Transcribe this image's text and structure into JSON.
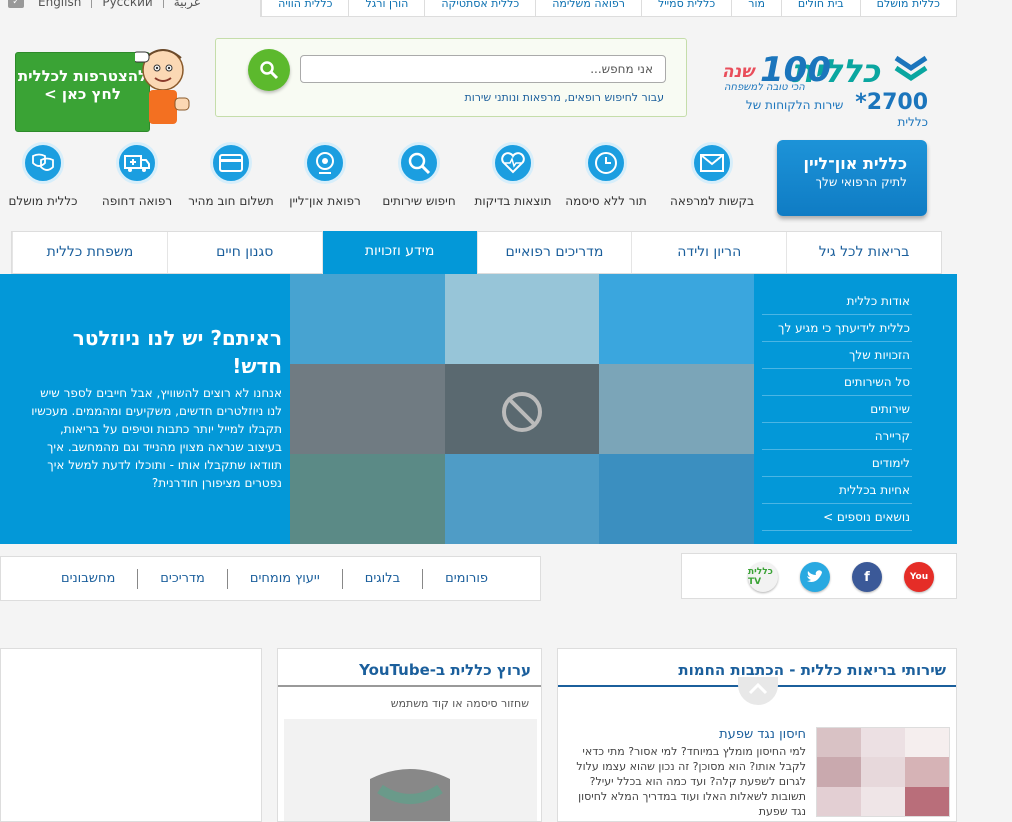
{
  "topbar": {
    "lang_english": "English",
    "lang_russian": "Русский",
    "lang_arabic": "عربية",
    "links": [
      "כללית מושלם",
      "בית חולים",
      "מור",
      "כללית סמייל",
      "רפואה משלימה",
      "כללית אסתטיקה",
      "הורן ורגל",
      "כללית הוויה"
    ]
  },
  "header": {
    "logo_text": "כללית",
    "logo_100": "100",
    "logo_shana": "שנה",
    "logo_tagline": "הכי טובה למשפחה",
    "phone_number": "2700*",
    "phone_label": "שירות הלקוחות של כללית",
    "search_placeholder": "אני מחפש...",
    "search_link": "עבור לחיפוש רופאים, מרפאות ונותני שירות",
    "join_text": "להצטרפות לכללית לחץ כאן >"
  },
  "online": {
    "title": "כללית און־ליין",
    "subtitle": "לתיק הרפואי שלך"
  },
  "icons": [
    {
      "label": "בקשות למרפאה",
      "icon": "envelope-icon"
    },
    {
      "label": "תור ללא סיסמה",
      "icon": "clock-icon"
    },
    {
      "label": "תוצאות בדיקות",
      "icon": "heartbeat-icon"
    },
    {
      "label": "חיפוש שירותים",
      "icon": "search-icon"
    },
    {
      "label": "רפואת און־ליין",
      "icon": "webcam-icon"
    },
    {
      "label": "תשלום חוב מהיר",
      "icon": "credit-card-icon"
    },
    {
      "label": "רפואה דחופה",
      "icon": "ambulance-icon"
    },
    {
      "label": "כללית מושלם",
      "icon": "masks-icon"
    }
  ],
  "tabs": [
    "בריאות לכל גיל",
    "הריון ולידה",
    "מדריכים רפואיים",
    "מידע וזכויות",
    "סגנון חיים",
    "משפחת כללית"
  ],
  "sidemenu": [
    "אודות כללית",
    "כללית לידיעתך כי מגיע לך",
    "הזכויות שלך",
    "סל השירותים",
    "שירותים",
    "קריירה",
    "לימודים",
    "אחיות בכללית",
    "נושאים נוספים >"
  ],
  "promo": {
    "heading": "ראיתם? יש לנו ניוזלטר חדש!",
    "body": "אנחנו לא רוצים להשוויץ, אבל חייבים לספר שיש לנו ניוזלטרים חדשים, משקיעים ומהממים. מעכשיו תקבלו למייל יותר כתבות וטיפים על בריאות, בעיצוב שנראה מצוין מהנייד וגם מהמחשב. איך תוודאו שתקבלו אותו - ותוכלו לדעת למשל איך נפטרים מציפורן חודרנית?"
  },
  "social": {
    "tv_label": "כללית TV"
  },
  "subnav": [
    "פורומים",
    "בלוגים",
    "ייעוץ מומחים",
    "מדריכים",
    "מחשבונים"
  ],
  "card1": {
    "title": "שירותי בריאות כללית - הכתבות החמות",
    "article_title": "חיסון נגד שפעת",
    "article_body": "למי החיסון מומלץ במיוחד? למי אסור? מתי כדאי לקבל אותו? הוא מסוכן? זה נכון שהוא עצמו עלול לגרום לשפעת קלה? ועד כמה הוא בכלל יעיל? תשובות לשאלות האלו ועוד במדריך המלא לחיסון נגד שפעת"
  },
  "card2": {
    "title": "ערוץ כללית ב-YouTube",
    "subtitle": "שחזור סיסמה או קוד משתמש"
  },
  "colors": {
    "brand_blue": "#0398d8",
    "green": "#3aa335",
    "link": "#1b5f9c"
  }
}
